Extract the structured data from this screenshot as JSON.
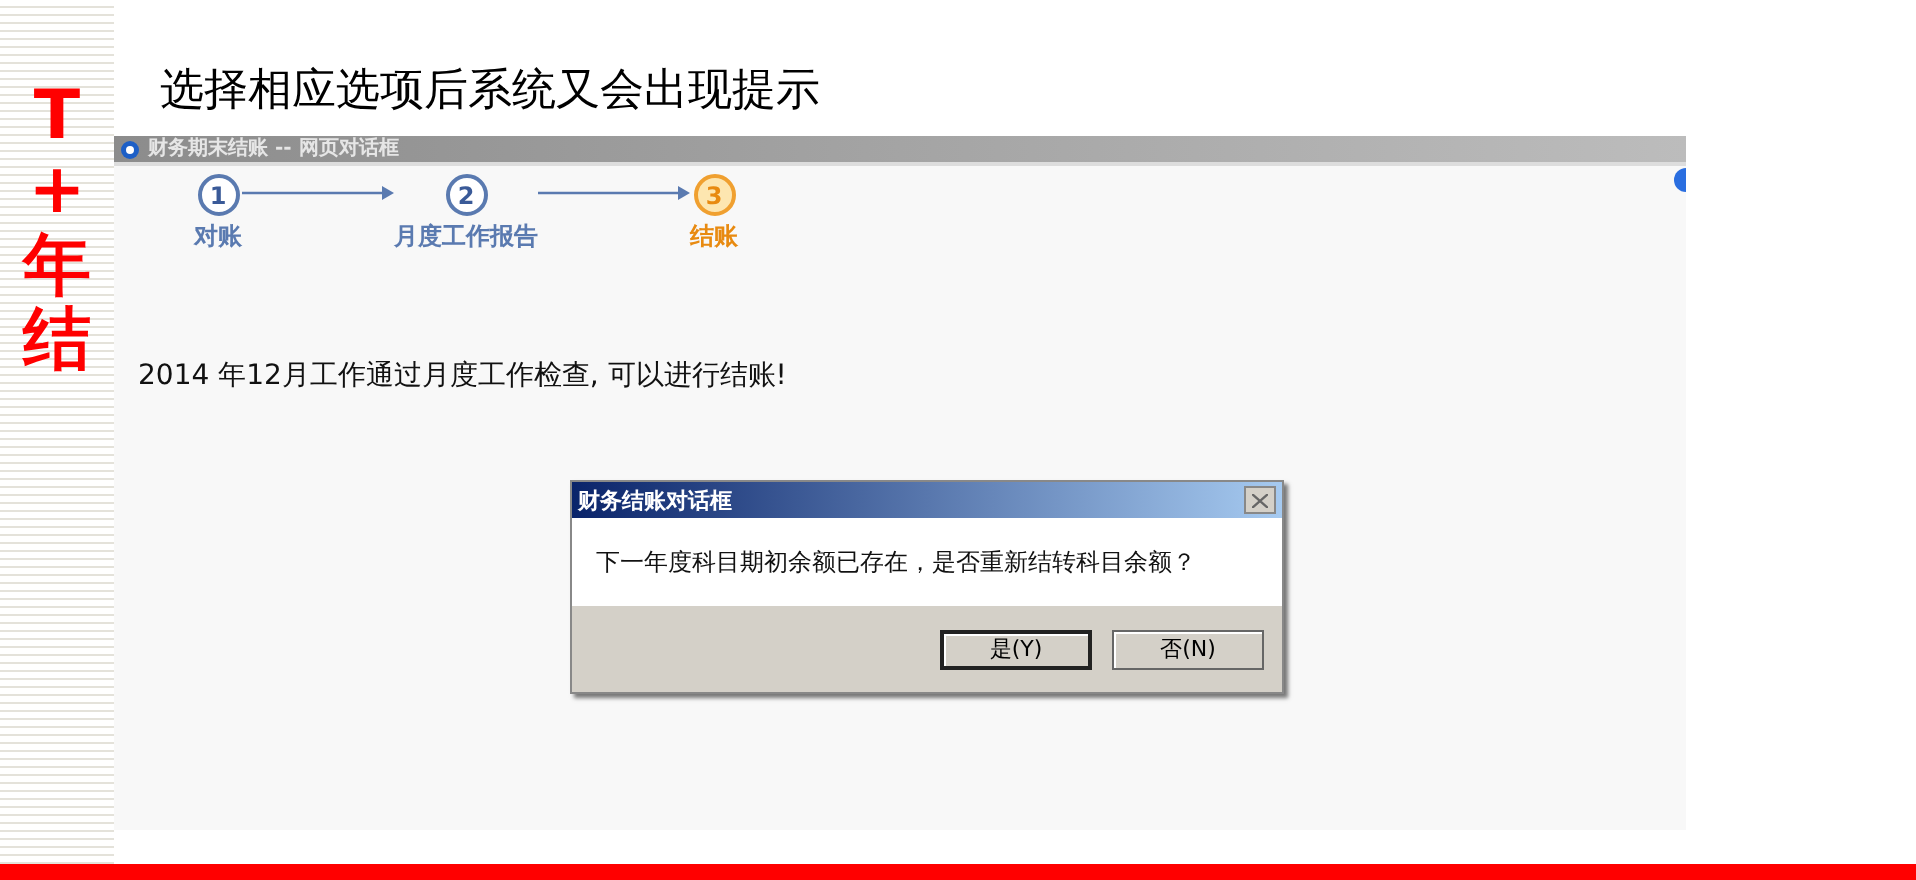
{
  "slide": {
    "side_title": "T+年结",
    "title": "选择相应选项后系统又会出现提示"
  },
  "window": {
    "title": "财务期末结账 -- 网页对话框",
    "steps": [
      {
        "number": "1",
        "label": "对账",
        "selected": false
      },
      {
        "number": "2",
        "label": "月度工作报告",
        "selected": false
      },
      {
        "number": "3",
        "label": "结账",
        "selected": true
      }
    ],
    "message": "2014 年12月工作通过月度工作检查, 可以进行结账!"
  },
  "dialog": {
    "title": "财务结账对话框",
    "message": "下一年度科目期初余额已存在，是否重新结转科目余额？",
    "buttons": [
      {
        "label": "是(Y)",
        "selected": true
      },
      {
        "label": "否(N)",
        "selected": false
      }
    ]
  }
}
